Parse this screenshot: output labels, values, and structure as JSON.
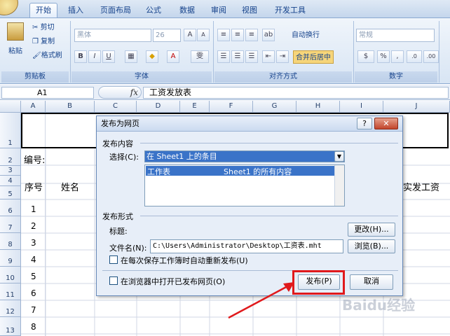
{
  "ribbon": {
    "tabs": [
      "开始",
      "插入",
      "页面布局",
      "公式",
      "数据",
      "审阅",
      "视图",
      "开发工具"
    ],
    "clipboard": {
      "paste": "粘贴",
      "cut": "剪切",
      "copy": "复制",
      "format_painter": "格式刷",
      "label": "剪贴板"
    },
    "font": {
      "name": "黑体",
      "size": "26",
      "label": "字体",
      "bold": "B",
      "italic": "I",
      "underline": "U",
      "wen": "雯"
    },
    "alignment": {
      "wrap": "自动换行",
      "merge": "合并后居中",
      "label": "对齐方式"
    },
    "number": {
      "format": "常规",
      "label": "数字"
    }
  },
  "formula_bar": {
    "cell_ref": "A1",
    "fx": "fx",
    "content": "工资发放表"
  },
  "sheet": {
    "columns": [
      "A",
      "B",
      "C",
      "D",
      "E",
      "F",
      "G",
      "H",
      "I",
      "J"
    ],
    "rows": [
      "1",
      "2",
      "3",
      "4",
      "5",
      "6",
      "7",
      "8",
      "9",
      "10",
      "11",
      "12",
      "13"
    ],
    "a2": "编号:",
    "seq_header": "序号",
    "name_header": "姓名",
    "pay_header": "实发工资",
    "seq_values": [
      "1",
      "2",
      "3",
      "4",
      "5",
      "6",
      "7",
      "8"
    ]
  },
  "dialog": {
    "title": "发布为网页",
    "help": "?",
    "close": "✕",
    "section_content": "发布内容",
    "select_label": "选择(C):",
    "select_value": "在 Sheet1 上的条目",
    "list_item_left": "工作表",
    "list_item_right": "Sheet1 的所有内容",
    "section_format": "发布形式",
    "title_label": "标题:",
    "change_btn": "更改(H)...",
    "filename_label": "文件名(N):",
    "filename_value": "C:\\Users\\Administrator\\Desktop\\工资表.mht",
    "browse_btn": "浏览(B)...",
    "autorepublish": "在每次保存工作簿时自动重新发布(U)",
    "open_in_browser": "在浏览器中打开已发布网页(O)",
    "publish_btn": "发布(P)",
    "cancel_btn": "取消"
  },
  "watermark": "Baidu经验"
}
